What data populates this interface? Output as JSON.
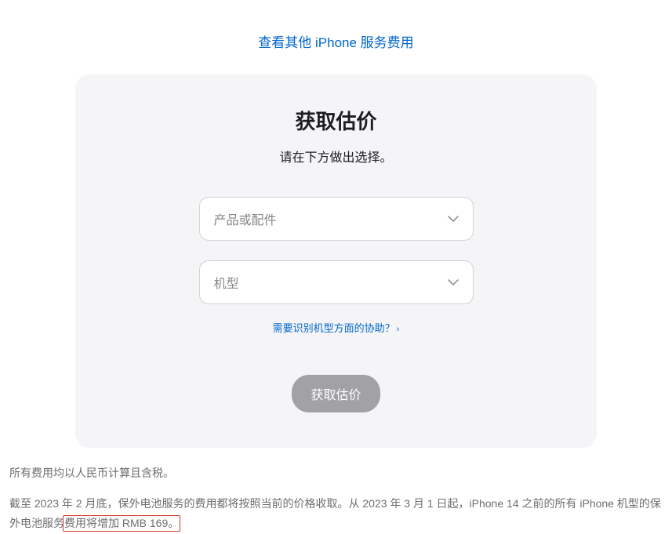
{
  "topLink": {
    "text": "查看其他 iPhone 服务费用"
  },
  "card": {
    "title": "获取估价",
    "subtitle": "请在下方做出选择。",
    "select1": {
      "placeholder": "产品或配件"
    },
    "select2": {
      "placeholder": "机型"
    },
    "helpLink": {
      "text": "需要识别机型方面的协助？"
    },
    "submitButton": {
      "label": "获取估价"
    }
  },
  "footer": {
    "note1": "所有费用均以人民币计算且含税。",
    "note2_part1": "截至 2023 年 2 月底，保外电池服务的费用都将按照当前的价格收取。从 2023 年 3 月 1 日起，iPhone 14 之前的所有 iPhone 机型的保外电池服务",
    "note2_highlight": "费用将增加 RMB 169。"
  }
}
